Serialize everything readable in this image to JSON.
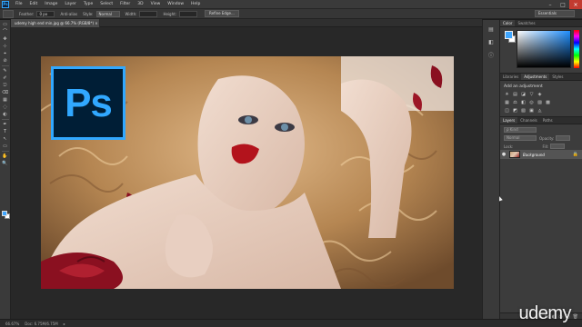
{
  "menu": {
    "app_logo": "Ps",
    "items": [
      "File",
      "Edit",
      "Image",
      "Layer",
      "Type",
      "Select",
      "Filter",
      "3D",
      "View",
      "Window",
      "Help"
    ],
    "window_controls": [
      "–",
      "□",
      "×"
    ]
  },
  "options": {
    "feather_label": "Feather:",
    "feather_value": "0 px",
    "anti_alias": "Anti-alias",
    "style_label": "Style:",
    "style_value": "Normal",
    "width_label": "Width:",
    "height_label": "Height:",
    "refine_edge": "Refine Edge...",
    "workspace": "Essentials"
  },
  "document": {
    "tab_title": "udemy high end min.jpg @ 66.7% (RGB/8*) ×",
    "photo_colors": {
      "hair": "#c89a6a",
      "skin": "#e6cdbd",
      "lips": "#b3131c",
      "rose": "#8a1020"
    },
    "logo_text": "Ps",
    "logo_colors": {
      "bg": "#001e36",
      "accent": "#31a8ff"
    }
  },
  "tools": [
    "▭",
    "⌒",
    "✥",
    "⊹",
    "⌖",
    "⊘",
    "✎",
    "✐",
    "⎋",
    "⌫",
    "▦",
    "◌",
    "◐",
    "✒",
    "T",
    "↖",
    "▭",
    "✋",
    "🔍"
  ],
  "panels": {
    "color_tabs": [
      "Color",
      "Swatches"
    ],
    "color_fg": "#3fa6ff",
    "adj_tabs": [
      "Libraries",
      "Adjustments",
      "Styles"
    ],
    "adj_title": "Add an adjustment",
    "adj_icons_row1": [
      "☀",
      "▤",
      "◪",
      "▽",
      "◈"
    ],
    "adj_icons_row2": [
      "▦",
      "⚖",
      "◧",
      "◎",
      "▨",
      "▩"
    ],
    "adj_icons_row3": [
      "◫",
      "◩",
      "▧",
      "▣",
      "◬"
    ],
    "layers_tabs": [
      "Layers",
      "Channels",
      "Paths"
    ],
    "kind_label": "ρ Kind",
    "blend_mode": "Normal",
    "opacity_label": "Opacity:",
    "lock_label": "Lock:",
    "fill_label": "Fill:",
    "layer_name": "Background",
    "layer_lock": "🔒",
    "footer_icons": [
      "⊝",
      "fx",
      "◐",
      "▭",
      "▢",
      "🗑"
    ]
  },
  "status": {
    "zoom": "66.67%",
    "doc_size": "Doc: 6.75M/6.75M",
    "arrow": "▸"
  },
  "watermark": "udemy"
}
